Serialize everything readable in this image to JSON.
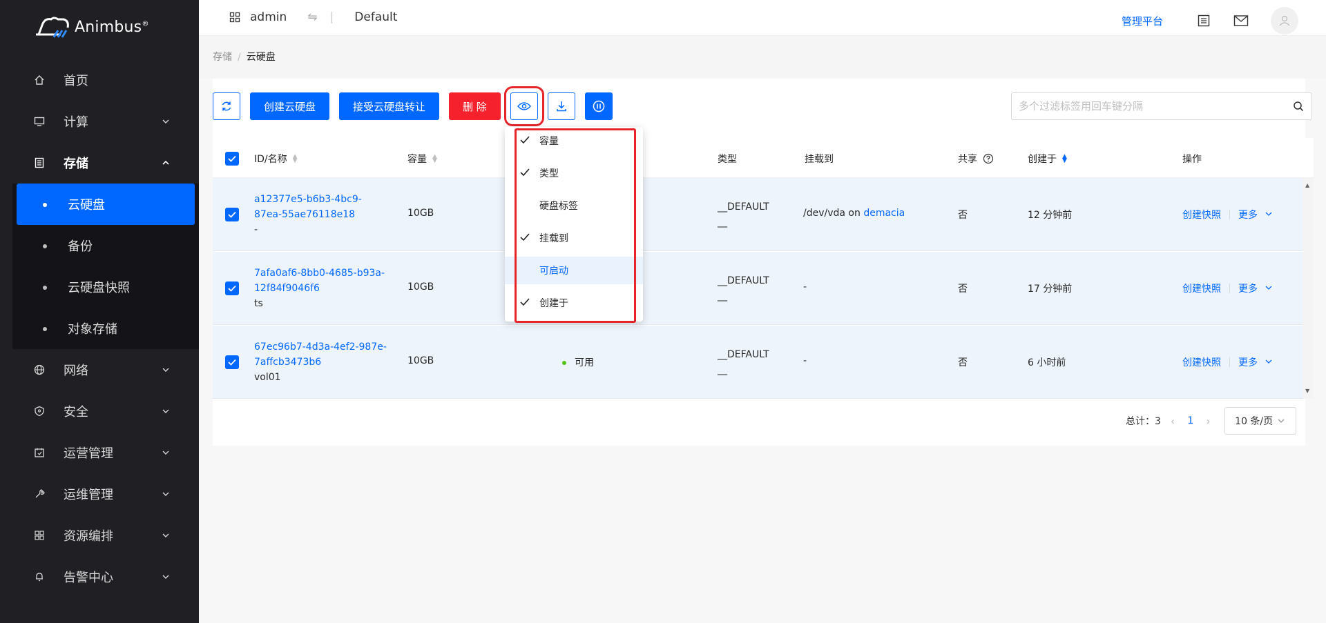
{
  "brand": {
    "name": "Animbus",
    "mark": "®"
  },
  "header": {
    "user": "admin",
    "project": "Default",
    "mgmt_link": "管理平台"
  },
  "sidebar": {
    "items": [
      {
        "label": "首页",
        "icon": "home-icon"
      },
      {
        "label": "计算",
        "icon": "monitor-icon"
      },
      {
        "label": "存储",
        "icon": "storage-icon"
      },
      {
        "label": "网络",
        "icon": "globe-icon"
      },
      {
        "label": "安全",
        "icon": "shield-icon"
      },
      {
        "label": "运营管理",
        "icon": "calendar-icon"
      },
      {
        "label": "运维管理",
        "icon": "wrench-icon"
      },
      {
        "label": "资源编排",
        "icon": "grid-icon"
      },
      {
        "label": "告警中心",
        "icon": "bell-icon"
      }
    ],
    "storage_sub": [
      {
        "label": "云硬盘"
      },
      {
        "label": "备份"
      },
      {
        "label": "云硬盘快照"
      },
      {
        "label": "对象存储"
      }
    ]
  },
  "breadcrumb": {
    "parent": "存储",
    "current": "云硬盘"
  },
  "toolbar": {
    "create": "创建云硬盘",
    "accept_transfer": "接受云硬盘转让",
    "delete": "删 除"
  },
  "search": {
    "placeholder": "多个过滤标签用回车键分隔"
  },
  "table": {
    "headers": {
      "id_name": "ID/名称",
      "size": "容量",
      "type": "类型",
      "attached": "挂载到",
      "shared": "共享",
      "created": "创建于",
      "actions": "操作"
    },
    "rows": [
      {
        "id_line1": "a12377e5-b6b3-4bc9-",
        "id_line2": "87ea-55ae76118e18",
        "name": "-",
        "size": "10GB",
        "status": "",
        "type_line1": "__DEFAULT",
        "type_line2": "__",
        "attach_prefix": "/dev/vda on ",
        "attach_link": "demacia",
        "attach_plain": "",
        "shared": "否",
        "created": "12 分钟前",
        "action_snapshot": "创建快照",
        "action_more": "更多"
      },
      {
        "id_line1": "7afa0af6-8bb0-4685-b93a-",
        "id_line2": "12f84f9046f6",
        "name": "ts",
        "size": "10GB",
        "status": "",
        "type_line1": "__DEFAULT",
        "type_line2": "__",
        "attach_prefix": "",
        "attach_link": "",
        "attach_plain": "-",
        "shared": "否",
        "created": "17 分钟前",
        "action_snapshot": "创建快照",
        "action_more": "更多"
      },
      {
        "id_line1": "67ec96b7-4d3a-4ef2-987e-",
        "id_line2": "7affcb3473b6",
        "name": "vol01",
        "size": "10GB",
        "status": "可用",
        "type_line1": "__DEFAULT",
        "type_line2": "__",
        "attach_prefix": "",
        "attach_link": "",
        "attach_plain": "-",
        "shared": "否",
        "created": "6 小时前",
        "action_snapshot": "创建快照",
        "action_more": "更多"
      }
    ]
  },
  "pagination": {
    "total_label": "总计：3",
    "current_page": "1",
    "page_size": "10 条/页"
  },
  "column_menu": {
    "items": [
      {
        "label": "容量",
        "checked": true
      },
      {
        "label": "类型",
        "checked": true
      },
      {
        "label": "硬盘标签",
        "checked": false
      },
      {
        "label": "挂载到",
        "checked": true
      },
      {
        "label": "可启动",
        "checked": false
      },
      {
        "label": "创建于",
        "checked": true
      }
    ]
  },
  "colors": {
    "primary": "#0068ff",
    "danger": "#f5222d",
    "sidebar_bg": "#1f1f24",
    "highlight_red": "#e8242b"
  }
}
